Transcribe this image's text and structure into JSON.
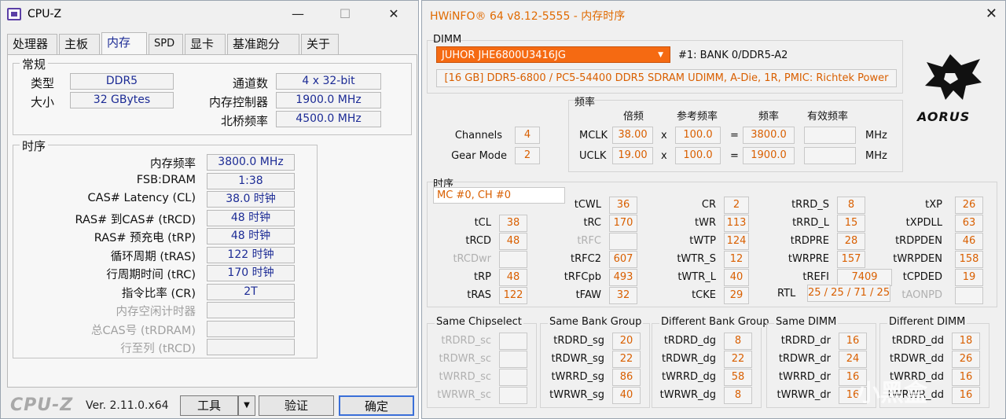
{
  "cpuz": {
    "title": "CPU-Z",
    "window_buttons": {
      "minimize": "—",
      "maximize": "☐",
      "close": "✕"
    },
    "tabs": [
      "处理器",
      "主板",
      "内存",
      "SPD",
      "显卡",
      "基准跑分",
      "关于"
    ],
    "general": {
      "title": "常规",
      "type_label": "类型",
      "type_value": "DDR5",
      "size_label": "大小",
      "size_value": "32 GBytes",
      "channels_label": "通道数",
      "channels_value": "4 x 32-bit",
      "mc_label": "内存控制器",
      "mc_value": "1900.0 MHz",
      "nb_label": "北桥频率",
      "nb_value": "4500.0 MHz"
    },
    "timings": {
      "title": "时序",
      "rows": [
        {
          "label": "内存频率",
          "value": "3800.0 MHz",
          "dim": false
        },
        {
          "label": "FSB:DRAM",
          "value": "1:38",
          "dim": false
        },
        {
          "label": "CAS# Latency (CL)",
          "value": "38.0 时钟",
          "dim": false
        },
        {
          "label": "RAS# 到CAS# (tRCD)",
          "value": "48 时钟",
          "dim": false
        },
        {
          "label": "RAS# 预充电 (tRP)",
          "value": "48 时钟",
          "dim": false
        },
        {
          "label": "循环周期 (tRAS)",
          "value": "122 时钟",
          "dim": false
        },
        {
          "label": "行周期时间 (tRC)",
          "value": "170 时钟",
          "dim": false
        },
        {
          "label": "指令比率 (CR)",
          "value": "2T",
          "dim": false
        },
        {
          "label": "内存空闲计时器",
          "value": "",
          "dim": true
        },
        {
          "label": "总CAS号 (tRDRAM)",
          "value": "",
          "dim": true
        },
        {
          "label": "行至列 (tRCD)",
          "value": "",
          "dim": true
        }
      ]
    },
    "footer": {
      "logo": "CPU-Z",
      "version": "Ver. 2.11.0.x64",
      "tools_button": "工具",
      "tools_dropdown": "▼",
      "validate_button": "验证",
      "ok_button": "确定"
    }
  },
  "hwinfo": {
    "title": "HWiNFO® 64 v8.12-5555 - 内存时序",
    "close": "✕",
    "dimm": {
      "label": "DIMM",
      "selected": "JUHOR JHE6800U3416JG",
      "dropdown_arrow": "▼",
      "bank": "#1: BANK 0/DDR5-A2",
      "info": "[16 GB] DDR5-6800 / PC5-54400 DDR5 SDRAM UDIMM, A-Die, 1R, PMIC: Richtek Power"
    },
    "logo_text": "AORUS",
    "freq": {
      "title": "频率",
      "headers": [
        "倍频",
        "参考频率",
        "频率",
        "有效频率"
      ],
      "channels_label": "Channels",
      "channels_value": "4",
      "gear_label": "Gear Mode",
      "gear_value": "2",
      "mclk": {
        "label": "MCLK",
        "mult": "38.00",
        "x": "x",
        "ref": "100.0",
        "eq": "=",
        "freq": "3800.0",
        "eff": "",
        "unit": "MHz"
      },
      "uclk": {
        "label": "UCLK",
        "mult": "19.00",
        "x": "x",
        "ref": "100.0",
        "eq": "=",
        "freq": "1900.0",
        "eff": "",
        "unit": "MHz"
      }
    },
    "timing": {
      "title": "时序",
      "mc": "MC #0, CH #0",
      "col1": [
        {
          "label": "tCL",
          "value": "38",
          "dim": false
        },
        {
          "label": "tRCD",
          "value": "48",
          "dim": false
        },
        {
          "label": "tRCDwr",
          "value": "",
          "dim": true
        },
        {
          "label": "tRP",
          "value": "48",
          "dim": false
        },
        {
          "label": "tRAS",
          "value": "122",
          "dim": false
        }
      ],
      "col2": [
        {
          "label": "tCWL",
          "value": "36",
          "dim": false
        },
        {
          "label": "tRC",
          "value": "170",
          "dim": false
        },
        {
          "label": "tRFC",
          "value": "",
          "dim": true
        },
        {
          "label": "tRFC2",
          "value": "607",
          "dim": false
        },
        {
          "label": "tRFCpb",
          "value": "493",
          "dim": false
        },
        {
          "label": "tFAW",
          "value": "32",
          "dim": false
        }
      ],
      "col3": [
        {
          "label": "CR",
          "value": "2",
          "dim": false
        },
        {
          "label": "tWR",
          "value": "113",
          "dim": false
        },
        {
          "label": "tWTP",
          "value": "124",
          "dim": false
        },
        {
          "label": "tWTR_S",
          "value": "12",
          "dim": false
        },
        {
          "label": "tWTR_L",
          "value": "40",
          "dim": false
        },
        {
          "label": "tCKE",
          "value": "29",
          "dim": false
        }
      ],
      "col4": [
        {
          "label": "tRRD_S",
          "value": "8",
          "dim": false
        },
        {
          "label": "tRRD_L",
          "value": "15",
          "dim": false
        },
        {
          "label": "tRDPRE",
          "value": "28",
          "dim": false
        },
        {
          "label": "tWRPRE",
          "value": "157",
          "dim": false
        },
        {
          "label": "tREFI",
          "value": "7409",
          "dim": false
        }
      ],
      "rtl_label": "RTL",
      "rtl_value": "25 / 25 / 71 / 25",
      "col5": [
        {
          "label": "tXP",
          "value": "26",
          "dim": false
        },
        {
          "label": "tXPDLL",
          "value": "63",
          "dim": false
        },
        {
          "label": "tRDPDEN",
          "value": "46",
          "dim": false
        },
        {
          "label": "tWRPDEN",
          "value": "158",
          "dim": false
        },
        {
          "label": "tCPDED",
          "value": "19",
          "dim": false
        },
        {
          "label": "tAONPD",
          "value": "",
          "dim": true
        }
      ]
    },
    "turnaround": [
      {
        "title": "Same Chipselect",
        "rows": [
          {
            "label": "tRDRD_sc",
            "value": "",
            "dim": true
          },
          {
            "label": "tRDWR_sc",
            "value": "",
            "dim": true
          },
          {
            "label": "tWRRD_sc",
            "value": "",
            "dim": true
          },
          {
            "label": "tWRWR_sc",
            "value": "",
            "dim": true
          }
        ]
      },
      {
        "title": "Same Bank Group",
        "rows": [
          {
            "label": "tRDRD_sg",
            "value": "20",
            "dim": false
          },
          {
            "label": "tRDWR_sg",
            "value": "22",
            "dim": false
          },
          {
            "label": "tWRRD_sg",
            "value": "86",
            "dim": false
          },
          {
            "label": "tWRWR_sg",
            "value": "40",
            "dim": false
          }
        ]
      },
      {
        "title": "Different Bank Group",
        "rows": [
          {
            "label": "tRDRD_dg",
            "value": "8",
            "dim": false
          },
          {
            "label": "tRDWR_dg",
            "value": "22",
            "dim": false
          },
          {
            "label": "tWRRD_dg",
            "value": "58",
            "dim": false
          },
          {
            "label": "tWRWR_dg",
            "value": "8",
            "dim": false
          }
        ]
      },
      {
        "title": "Same DIMM",
        "rows": [
          {
            "label": "tRDRD_dr",
            "value": "16",
            "dim": false
          },
          {
            "label": "tRDWR_dr",
            "value": "24",
            "dim": false
          },
          {
            "label": "tWRRD_dr",
            "value": "16",
            "dim": false
          },
          {
            "label": "tWRWR_dr",
            "value": "16",
            "dim": false
          }
        ]
      },
      {
        "title": "Different DIMM",
        "rows": [
          {
            "label": "tRDRD_dd",
            "value": "18",
            "dim": false
          },
          {
            "label": "tRDWR_dd",
            "value": "26",
            "dim": false
          },
          {
            "label": "tWRRD_dd",
            "value": "16",
            "dim": false
          },
          {
            "label": "tWRWR_dd",
            "value": "16",
            "dim": false
          }
        ]
      }
    ]
  },
  "watermark": "小黑盒",
  "colors": {
    "cpuz_value": "#1c2b95",
    "hwinfo_value": "#d95f00",
    "dimm_select": "#f56a12"
  }
}
